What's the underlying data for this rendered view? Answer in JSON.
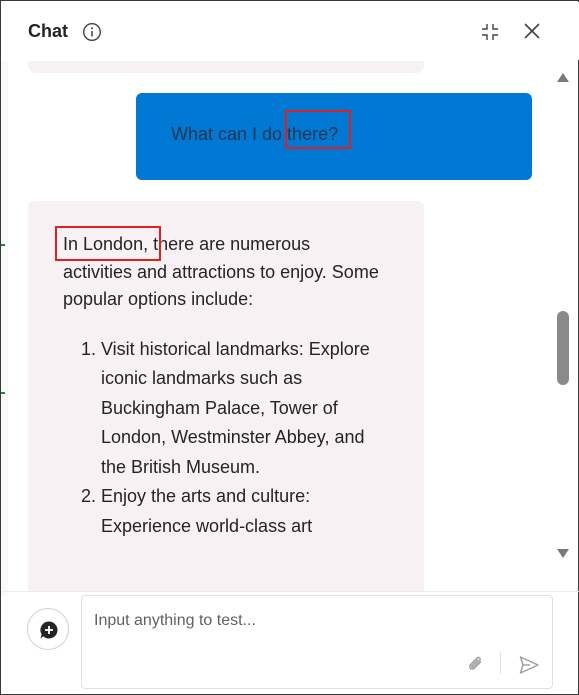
{
  "header": {
    "title": "Chat",
    "icons": [
      "info-icon",
      "collapse-icon",
      "close-icon"
    ]
  },
  "messages": {
    "user": {
      "text": "What can I do there?"
    },
    "bot": {
      "intro": "In London, there are numerous activities and attractions to enjoy. Some popular options include:",
      "items": [
        {
          "number": "1.",
          "text": "Visit historical landmarks: Explore iconic landmarks such as Buckingham Palace, Tower of London, Westminster Abbey, and the British Museum."
        },
        {
          "number": "2.",
          "text": "Enjoy the arts and culture: Experience world-class art"
        }
      ]
    }
  },
  "composer": {
    "placeholder": "Input anything to test...",
    "icons": [
      "new-chat-icon",
      "attach-icon",
      "send-icon"
    ]
  },
  "colors": {
    "user_bubble": "#0078d4",
    "bot_bubble": "#f7f1f3",
    "highlight": "#e02020"
  }
}
